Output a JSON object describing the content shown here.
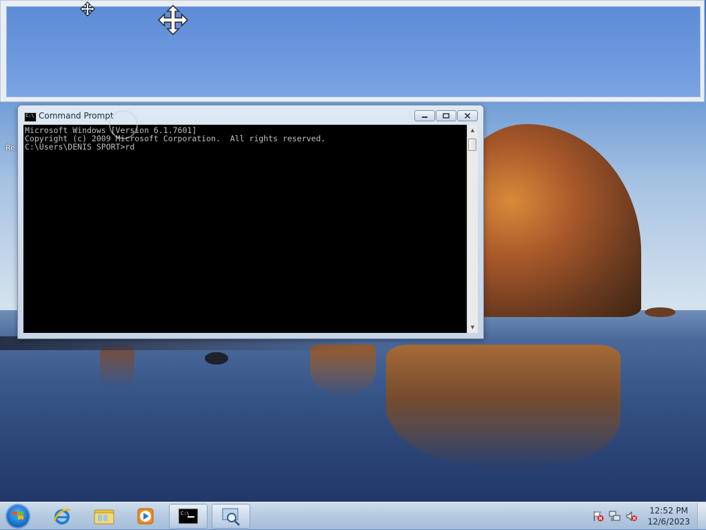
{
  "desktop": {
    "partial_icon_label": "Re"
  },
  "cmd_window": {
    "title": "Command Prompt",
    "icon_glyph": "C:\\",
    "lines": [
      "Microsoft Windows [Version 6.1.7601]",
      "Copyright (c) 2009 Microsoft Corporation.  All rights reserved.",
      "",
      "C:\\Users\\DENIS SPORT>rd"
    ]
  },
  "taskbar": {
    "items": [
      {
        "name": "internet-explorer",
        "icon": "ie-icon"
      },
      {
        "name": "windows-explorer",
        "icon": "folder-icon"
      },
      {
        "name": "media-player",
        "icon": "media-player-icon"
      },
      {
        "name": "command-prompt",
        "icon": "cmd-icon",
        "active": true
      },
      {
        "name": "magnifier",
        "icon": "magnifier-icon",
        "active": true
      }
    ],
    "clock": {
      "time": "12:52 PM",
      "date": "12/6/2023"
    },
    "tray_icons": [
      "action-center-icon",
      "network-icon",
      "volume-muted-icon"
    ]
  },
  "colors": {
    "accent": "#1d6fc9",
    "console_bg": "#000000",
    "console_text": "#c0c0c0"
  }
}
